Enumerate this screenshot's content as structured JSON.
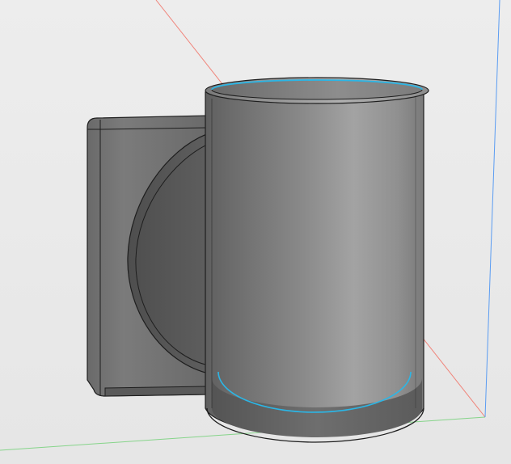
{
  "viewport": {
    "background_color": "#e8e8e8",
    "axes": {
      "x_axis_color": "#f0847a",
      "y_axis_color": "#86d48a",
      "z_axis_color": "#5a9cf2"
    }
  },
  "model": {
    "name": "mug",
    "body_color": "#8f8f8f",
    "edge_color": "#1e1e1e",
    "selected_edge_color": "#2bb6e6",
    "selected_edges": [
      "rim-inner-edge",
      "base-fillet-edge"
    ]
  }
}
